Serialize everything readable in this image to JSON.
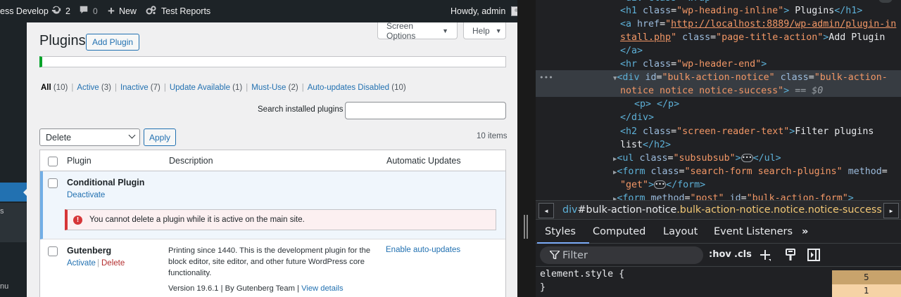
{
  "adminbar": {
    "site_name": "ess Develop",
    "updates_count": "2",
    "comments_count": "0",
    "new_label": "New",
    "test_reports": "Test Reports",
    "howdy": "Howdy, admin"
  },
  "adminmenu": {
    "fragment_1": "s",
    "fragment_2": "nu"
  },
  "screen_meta": {
    "screen_options": "Screen Options",
    "help": "Help"
  },
  "page": {
    "title": "Plugins",
    "add_plugin": "Add Plugin"
  },
  "filters": [
    {
      "label": "All",
      "count": "(10)",
      "current": true
    },
    {
      "label": "Active",
      "count": "(3)"
    },
    {
      "label": "Inactive",
      "count": "(7)"
    },
    {
      "label": "Update Available",
      "count": "(1)"
    },
    {
      "label": "Must-Use",
      "count": "(2)"
    },
    {
      "label": "Auto-updates Disabled",
      "count": "(10)"
    }
  ],
  "search": {
    "label": "Search installed plugins",
    "value": ""
  },
  "bulk": {
    "selected": "Delete",
    "apply": "Apply",
    "items": "10 items"
  },
  "table": {
    "headers": [
      "Plugin",
      "Description",
      "Automatic Updates"
    ],
    "rows": [
      {
        "name": "Conditional Plugin",
        "actions": [
          "Deactivate"
        ],
        "error": "You cannot delete a plugin while it is active on the main site."
      },
      {
        "name": "Gutenberg",
        "actions": [
          "Activate",
          "Delete"
        ],
        "description": "Printing since 1440. This is the development plugin for the block editor, site editor, and other future WordPress core functionality.",
        "meta_prefix": "Version 19.6.1 | By Gutenberg Team | ",
        "meta_link": "View details",
        "auto_update": "Enable auto-updates"
      }
    ]
  },
  "devtools": {
    "dom": {
      "h1_text": "Plugins",
      "a_href_1": "http://localhost:8889/wp-admin/plugin-in",
      "a_href_2": "stall.php",
      "a_class": "page-title-action",
      "a_text": "Add Plugin",
      "hr_class": "wp-header-end",
      "div_id": "bulk-action-notice",
      "div_class_1": "bulk-action-",
      "div_class_2": "notice notice notice-success",
      "eq0": "== $0",
      "h2_class": "screen-reader-text",
      "h2_text_1": "Filter plugins",
      "h2_text_2": "list",
      "ul_class": "subsubsub",
      "form_class": "search-form search-plugins",
      "form_method": "get"
    },
    "breadcrumb": {
      "tag": "div",
      "id": "#bulk-action-notice",
      "classes": ".bulk-action-notice.notice.notice-success"
    },
    "tabs": [
      "Styles",
      "Computed",
      "Layout",
      "Event Listeners"
    ],
    "filter_placeholder": "Filter",
    "hov": ":hov",
    "cls": ".cls",
    "element_style": "element.style {",
    "close_brace": "}",
    "boxmodel": [
      "5",
      "1"
    ]
  }
}
